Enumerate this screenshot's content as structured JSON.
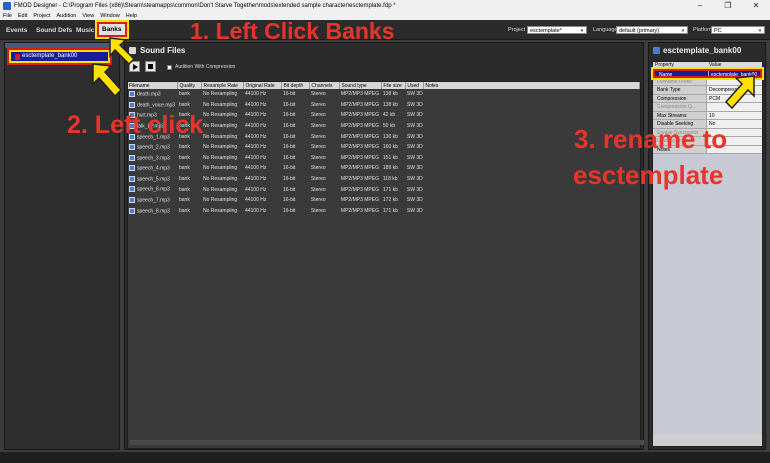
{
  "window": {
    "title": "FMOD Designer - C:\\Program Files (x86)\\Steam\\steamapps\\common\\Don't Starve Together\\mods\\extended sample character\\esctemplate.fdp *",
    "controls": [
      "–",
      "❐",
      "✕"
    ]
  },
  "menu": [
    "File",
    "Edit",
    "Project",
    "Audition",
    "View",
    "Window",
    "Help"
  ],
  "tabs": {
    "events": "Events",
    "sound_defs": "Sound Defs",
    "music": "Music",
    "banks": "Banks"
  },
  "toolbar": {
    "project_label": "Project",
    "project_value": "esctemplate*",
    "language_label": "Language",
    "language_value": "default (primary)",
    "platform_label": "Platform",
    "platform_value": "PC"
  },
  "annotations": {
    "step1": "1. Left Click Banks",
    "step2": "2. Left click",
    "step3a": "3. rename to",
    "step3b": "esctemplate"
  },
  "left_panel": {
    "bank_item": "esctemplate_bank00"
  },
  "sound_files": {
    "title": "Sound Files",
    "audition_label": "Audition With Compression",
    "columns": [
      "Filename",
      "Quality",
      "Resample Rate",
      "Original Rate",
      "Bit depth",
      "Channels",
      "Sound type",
      "File size",
      "Used",
      "Notes"
    ],
    "rows": [
      [
        "death.mp3",
        "bank",
        "No Resampling",
        "44100 Hz",
        "16-bit",
        "Stereo",
        "MP2/MP3 MPEG",
        "138 kb",
        "SW 3D",
        ""
      ],
      [
        "death_voice.mp3",
        "bank",
        "No Resampling",
        "44100 Hz",
        "16-bit",
        "Stereo",
        "MP2/MP3 MPEG",
        "138 kb",
        "SW 3D",
        ""
      ],
      [
        "hurt.mp3",
        "bank",
        "No Resampling",
        "44100 Hz",
        "16-bit",
        "Stereo",
        "MP2/MP3 MPEG",
        "42 kb",
        "SW 3D",
        ""
      ],
      [
        "talk_LP.mp3",
        "bank",
        "No Resampling",
        "44100 Hz",
        "16-bit",
        "Stereo",
        "MP2/MP3 MPEG",
        "50 kb",
        "SW 3D",
        ""
      ],
      [
        "speech_1.mp3",
        "bank",
        "No Resampling",
        "44100 Hz",
        "16-bit",
        "Stereo",
        "MP2/MP3 MPEG",
        "130 kb",
        "SW 3D",
        ""
      ],
      [
        "speech_2.mp3",
        "bank",
        "No Resampling",
        "44100 Hz",
        "16-bit",
        "Stereo",
        "MP2/MP3 MPEG",
        "160 kb",
        "SW 3D",
        ""
      ],
      [
        "speech_3.mp3",
        "bank",
        "No Resampling",
        "44100 Hz",
        "16-bit",
        "Stereo",
        "MP2/MP3 MPEG",
        "151 kb",
        "SW 3D",
        ""
      ],
      [
        "speech_4.mp3",
        "bank",
        "No Resampling",
        "44100 Hz",
        "16-bit",
        "Stereo",
        "MP2/MP3 MPEG",
        "189 kb",
        "SW 3D",
        ""
      ],
      [
        "speech_5.mp3",
        "bank",
        "No Resampling",
        "44100 Hz",
        "16-bit",
        "Stereo",
        "MP2/MP3 MPEG",
        "118 kb",
        "SW 3D",
        ""
      ],
      [
        "speech_6.mp3",
        "bank",
        "No Resampling",
        "44100 Hz",
        "16-bit",
        "Stereo",
        "MP2/MP3 MPEG",
        "171 kb",
        "SW 3D",
        ""
      ],
      [
        "speech_7.mp3",
        "bank",
        "No Resampling",
        "44100 Hz",
        "16-bit",
        "Stereo",
        "MP2/MP3 MPEG",
        "172 kb",
        "SW 3D",
        ""
      ],
      [
        "speech_8.mp3",
        "bank",
        "No Resampling",
        "44100 Hz",
        "16-bit",
        "Stereo",
        "MP2/MP3 MPEG",
        "171 kb",
        "SW 3D",
        ""
      ]
    ]
  },
  "properties": {
    "title": "esctemplate_bank00",
    "header_k": "Property",
    "header_v": "Value",
    "rows": [
      {
        "k": "Name",
        "v": "esctemplate_bank00",
        "sel": true
      },
      {
        "k": "Filename Prefix",
        "v": "",
        "dim": true
      },
      {
        "k": "Bank Type",
        "v": "Decompress"
      },
      {
        "k": "Compression",
        "v": "PCM"
      },
      {
        "k": "Compression Q...",
        "v": "",
        "dim": true
      },
      {
        "k": "Max Streams",
        "v": "10"
      },
      {
        "k": "Disable Seeking",
        "v": "No"
      },
      {
        "k": "Enable Syncpoints",
        "v": "",
        "dim": true
      },
      {
        "k": "Loading Mode",
        "v": "",
        "dim": true
      },
      {
        "k": "Notes",
        "v": ""
      }
    ]
  },
  "colors": {
    "annotation_red": "#e8352c",
    "highlight_yellow": "#ffe100",
    "selection_blue": "#1b1b9a"
  }
}
